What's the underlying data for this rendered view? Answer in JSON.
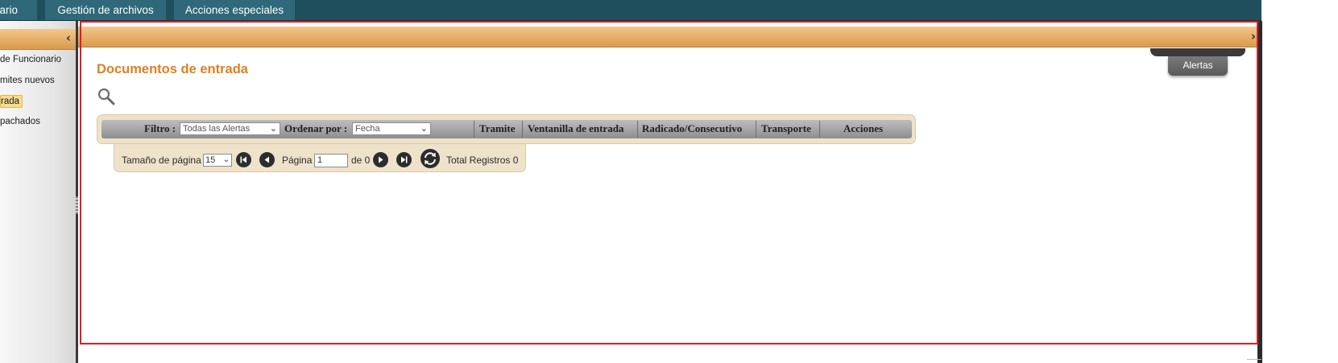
{
  "topnav": {
    "tabs": [
      {
        "label": "nario"
      },
      {
        "label": "Gestión de archivos"
      },
      {
        "label": "Acciones especiales"
      }
    ]
  },
  "sidebar": {
    "collapse_icon": "chevron-left-icon",
    "items": [
      {
        "label": "de Funcionario"
      },
      {
        "label": "mites nuevos"
      },
      {
        "label": "rada",
        "selected": true
      },
      {
        "label": "pachados"
      }
    ]
  },
  "main": {
    "expand_icon": "chevron-right-icon",
    "alerts_button": "Alertas",
    "title": "Documentos de entrada",
    "search_icon": "search-icon"
  },
  "grid": {
    "filter_label": "Filtro :",
    "filter_value": "Todas las Alertas",
    "order_label": "Ordenar por :",
    "order_value": "Fecha",
    "columns": [
      "Tramite",
      "Ventanilla de entrada",
      "Radicado/Consecutivo",
      "Transporte",
      "Acciones"
    ]
  },
  "pager": {
    "page_size_label": "Tamaño de página",
    "page_size_value": "15",
    "page_label": "Página",
    "page_value": "1",
    "of_label": "de 0",
    "total_label": "Total Registros 0"
  },
  "colors": {
    "nav_bg": "#1f4f5c",
    "nav_tab": "#2f6878",
    "accent_orange": "#e07f22",
    "header_orange": "#d99b4e",
    "highlight_red": "#d81f26",
    "grid_bg": "#efe2cb"
  }
}
